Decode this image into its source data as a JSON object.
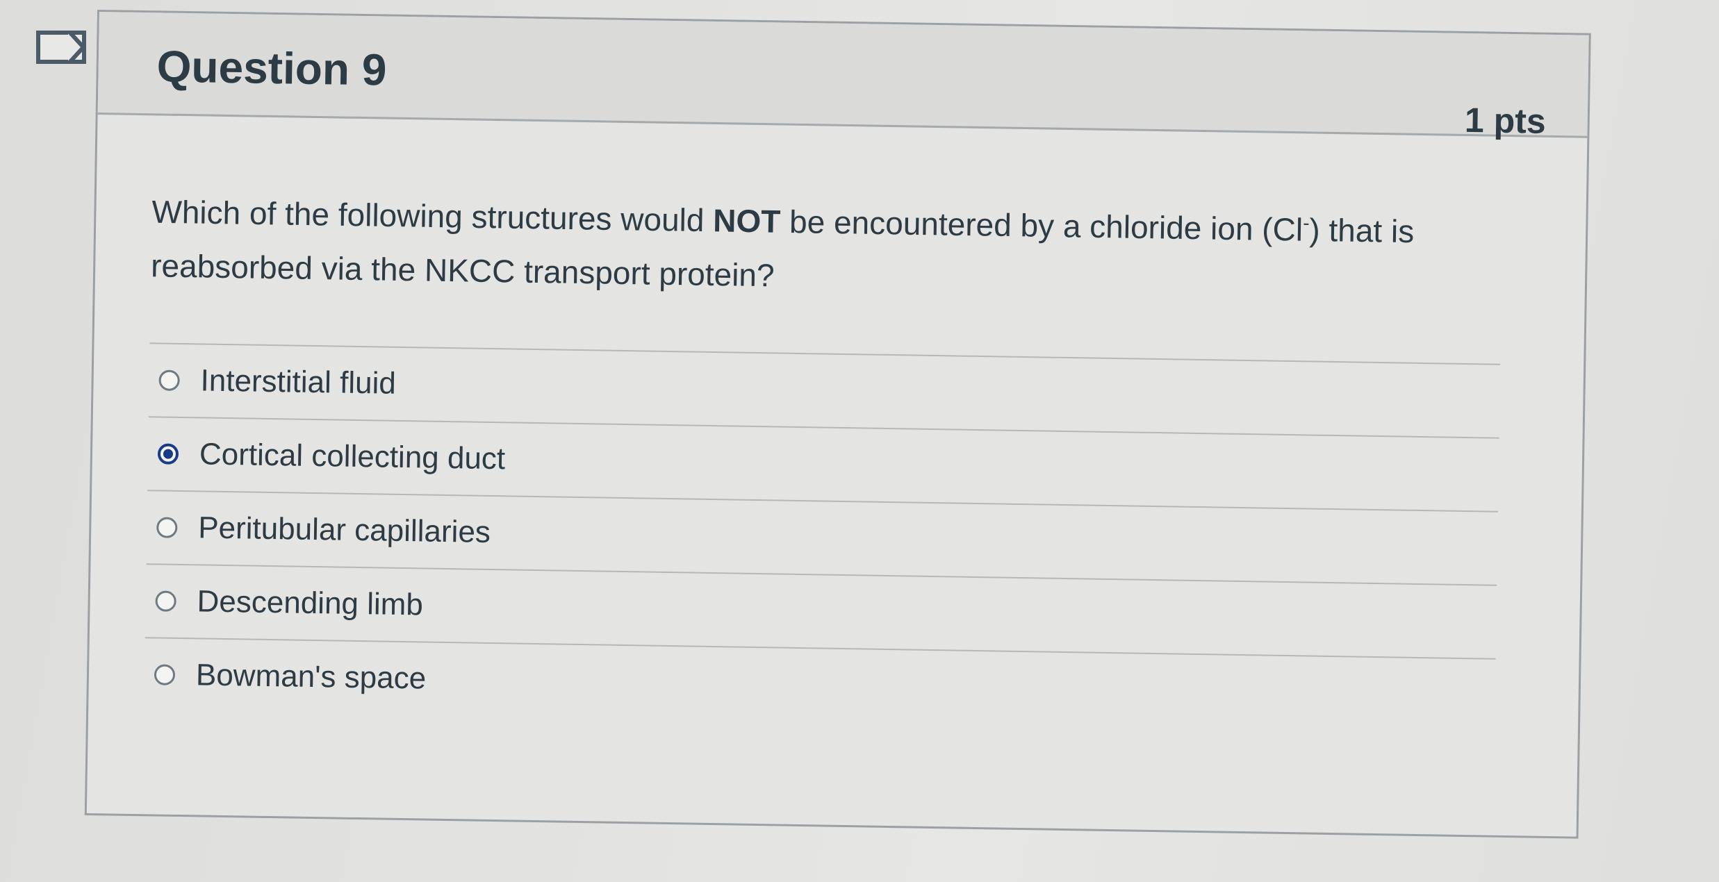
{
  "question": {
    "title": "Question 9",
    "points": "1 pts",
    "text_part1": "Which of the following structures would ",
    "text_bold": "NOT",
    "text_part2": " be encountered by a chloride ion (Cl",
    "text_superscript": "-",
    "text_part3": ") that is reabsorbed via the NKCC transport protein?"
  },
  "answers": [
    {
      "label": "Interstitial fluid",
      "selected": false
    },
    {
      "label": "Cortical collecting duct",
      "selected": true
    },
    {
      "label": "Peritubular capillaries",
      "selected": false
    },
    {
      "label": "Descending limb",
      "selected": false
    },
    {
      "label": "Bowman's space",
      "selected": false
    }
  ],
  "icons": {
    "flag": "flag-question-icon"
  },
  "colors": {
    "selected_radio": "#1a3b88",
    "text": "#2d3b45"
  }
}
